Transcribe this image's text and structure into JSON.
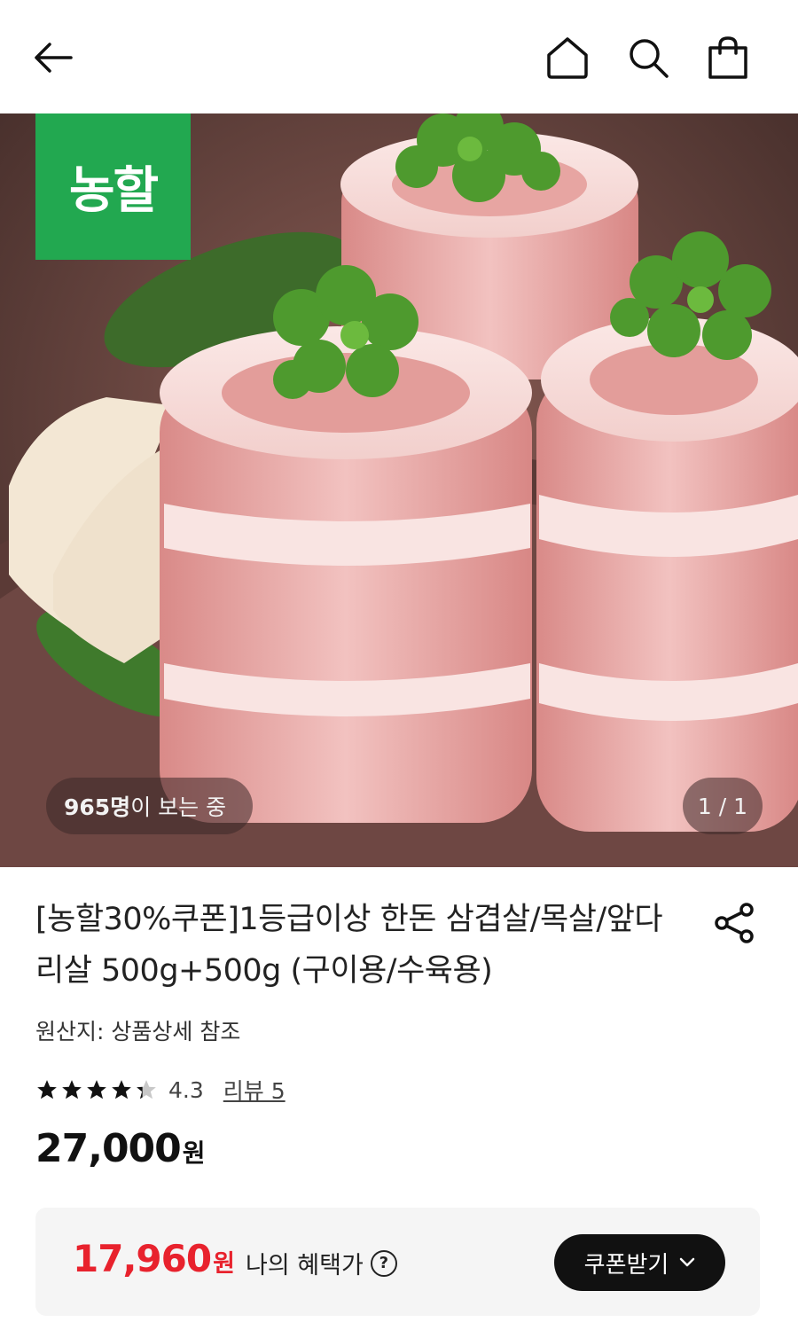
{
  "header": {
    "back_icon": "arrow-left-icon",
    "home_icon": "home-icon",
    "search_icon": "search-icon",
    "cart_icon": "shopping-bag-icon"
  },
  "hero": {
    "brand_logo_text": "농할",
    "brand_color": "#22a850",
    "viewers_count": "965명",
    "viewers_suffix": "이 보는 중",
    "page_indicator": "1 / 1"
  },
  "product": {
    "title": "[농할30%쿠폰]1등급이상 한돈 삼겹살/목살/앞다리살 500g+500g (구이용/수육용)",
    "origin": "원산지: 상품상세 참조",
    "rating": 4.3,
    "rating_text": "4.3",
    "review_link": "리뷰 5",
    "price_value": "27,000",
    "price_unit": "원"
  },
  "benefit": {
    "price_value": "17,960",
    "price_unit": "원",
    "label": "나의 혜택가",
    "help_glyph": "?",
    "coupon_button": "쿠폰받기",
    "accent_color": "#e8222d"
  }
}
